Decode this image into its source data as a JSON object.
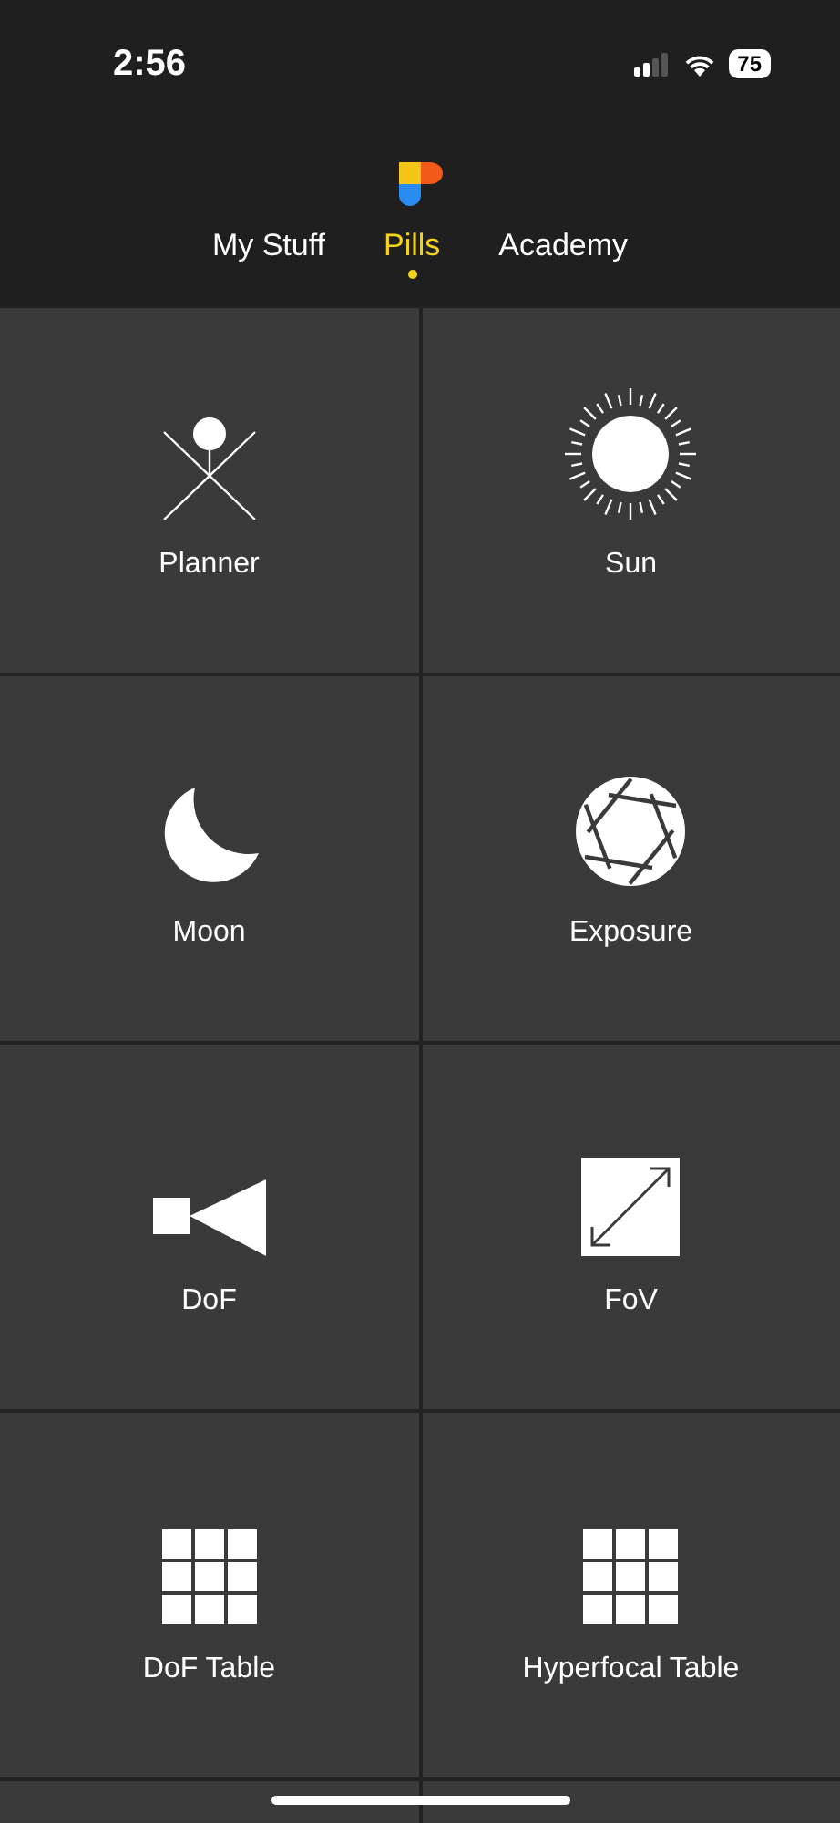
{
  "status_bar": {
    "time": "2:56",
    "battery": "75"
  },
  "tabs": [
    {
      "label": "My Stuff",
      "selected": false
    },
    {
      "label": "Pills",
      "selected": true
    },
    {
      "label": "Academy",
      "selected": false
    }
  ],
  "tiles": [
    {
      "label": "Planner",
      "kind": "planner"
    },
    {
      "label": "Sun",
      "kind": "sun"
    },
    {
      "label": "Moon",
      "kind": "moon"
    },
    {
      "label": "Exposure",
      "kind": "exposure"
    },
    {
      "label": "DoF",
      "kind": "dof"
    },
    {
      "label": "FoV",
      "kind": "fov"
    },
    {
      "label": "DoF Table",
      "kind": "table"
    },
    {
      "label": "Hyperfocal Table",
      "kind": "table"
    }
  ]
}
